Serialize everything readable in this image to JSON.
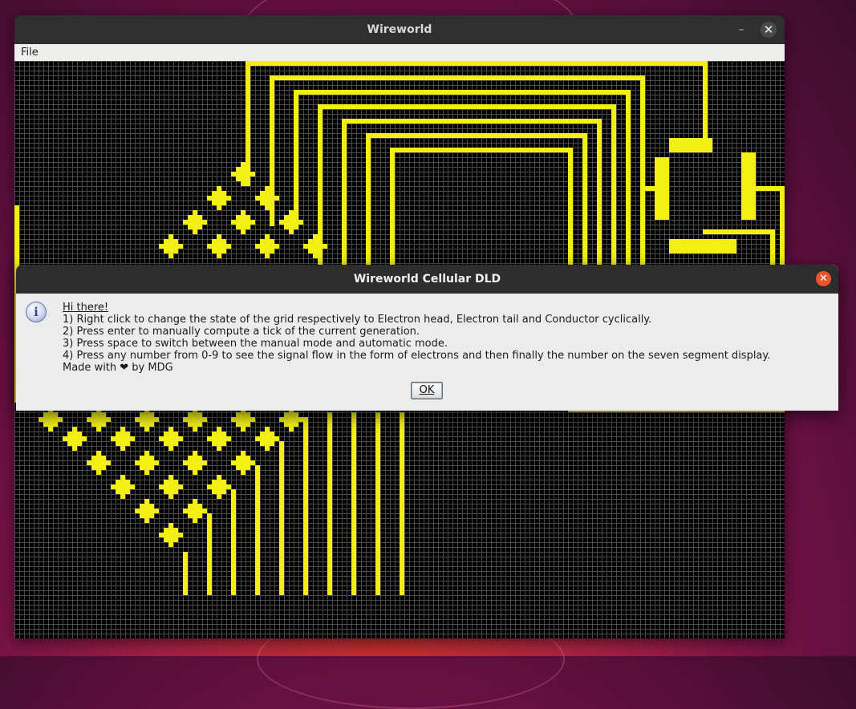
{
  "main_window": {
    "title": "Wireworld",
    "minimize_symbol": "–",
    "close_symbol": "✕",
    "menu": [
      "File"
    ]
  },
  "grid": {
    "cell_color": "#f2ef14",
    "grid_line_color": "#4b4b4b",
    "background_color": "#000000"
  },
  "dialog": {
    "title": "Wireworld Cellular DLD",
    "close_symbol": "✕",
    "icon": "info-icon",
    "heading": "Hi there!",
    "lines": [
      "1) Right click to change the state of the grid respectively to Electron head, Electron tail and Conductor cyclically.",
      "2) Press enter to manually compute a tick of the current generation.",
      "3) Press space to switch between the manual mode and automatic mode.",
      "4) Press any number from 0-9 to see the signal flow in the form of electrons and then finally the number on the seven segment display.",
      "Made with ❤ by MDG"
    ],
    "ok_label": "OK"
  },
  "accent_colors": {
    "dialog_close": "#e9542a",
    "desktop_top": "#3c0d2c",
    "desktop_bottom": "#c8322c"
  }
}
